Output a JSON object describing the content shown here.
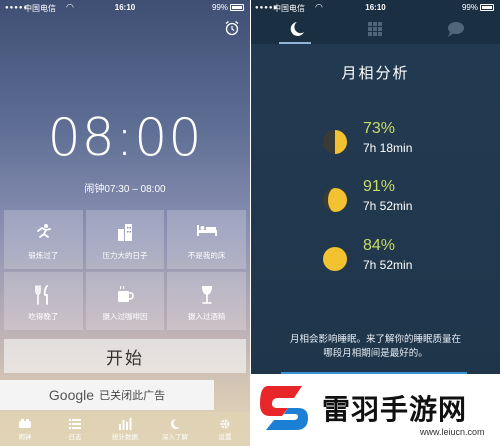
{
  "left_phone": {
    "status": {
      "carrier": "中国电信",
      "time": "16:10",
      "battery": "99%"
    },
    "clock": "08:00",
    "alarm_range": "闹钟07:30 – 08:00",
    "tiles": [
      {
        "label": "锻炼过了",
        "icon": "running-icon"
      },
      {
        "label": "压力大的日子",
        "icon": "buildings-icon"
      },
      {
        "label": "不是我的床",
        "icon": "bed-icon"
      },
      {
        "label": "吃得晚了",
        "icon": "fork-knife-icon"
      },
      {
        "label": "摄入过咖啡因",
        "icon": "coffee-cup-icon"
      },
      {
        "label": "摄入过酒精",
        "icon": "wine-glass-icon"
      }
    ],
    "start_button": "开始",
    "ad": {
      "brand": "Google",
      "text": "已关闭此广告"
    },
    "tabs": [
      {
        "label": "闹钟",
        "icon": "alarm-tab-icon"
      },
      {
        "label": "日志",
        "icon": "list-icon"
      },
      {
        "label": "统计数据",
        "icon": "bar-chart-icon"
      },
      {
        "label": "深入了解",
        "icon": "moon-icon"
      },
      {
        "label": "设置",
        "icon": "gear-icon"
      }
    ]
  },
  "right_phone": {
    "status": {
      "carrier": "中国电信",
      "time": "16:10",
      "battery": "99%"
    },
    "title": "月相分析",
    "phases": [
      {
        "percent": "73%",
        "duration": "7h 18min",
        "phase": "first-quarter"
      },
      {
        "percent": "91%",
        "duration": "7h 52min",
        "phase": "waxing-gibbous"
      },
      {
        "percent": "84%",
        "duration": "7h 52min",
        "phase": "full"
      }
    ],
    "description_line1": "月相会影响睡眠。来了解你的睡眠质量在",
    "description_line2": "哪段月相期间是最好的。"
  },
  "watermark": {
    "name": "雷羽手游网",
    "url": "www.leiucn.com"
  },
  "colors": {
    "moon": "#f2c230",
    "percent_text": "#c7dc66",
    "right_bg": "#213a50"
  }
}
